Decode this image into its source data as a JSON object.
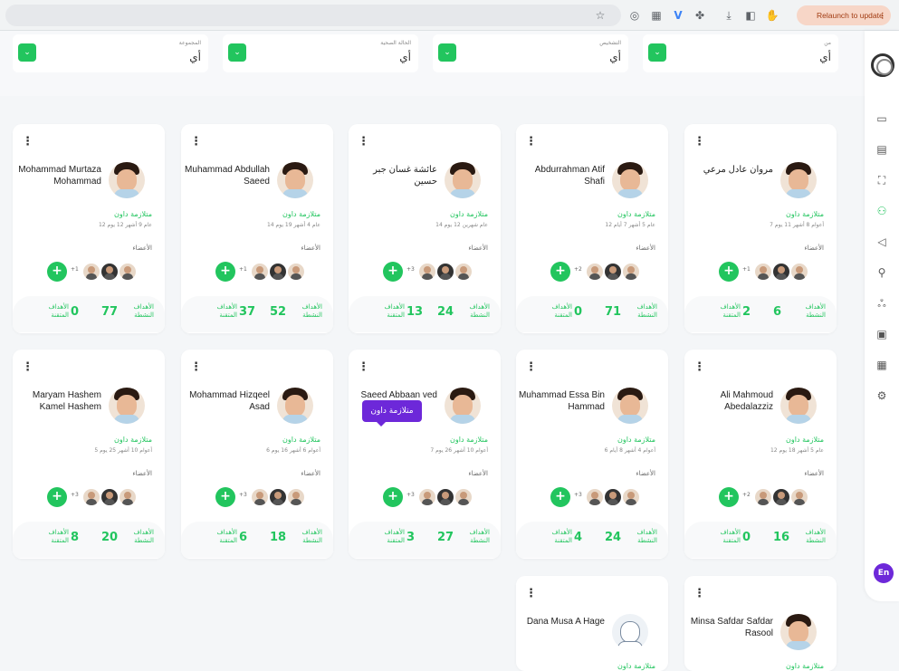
{
  "browser": {
    "relaunch_label": "Relaunch to update",
    "icons": [
      "star-icon",
      "camera-icon",
      "extension-icon",
      "vue-icon",
      "puzzle-icon",
      "download-icon",
      "sidebar-icon",
      "hand-icon"
    ]
  },
  "filters": [
    {
      "label": "المجموعة",
      "value": "أي"
    },
    {
      "label": "الحالة الصحية",
      "value": "أي"
    },
    {
      "label": "التشخيص",
      "value": "أي"
    },
    {
      "label": "من",
      "value": "أي"
    }
  ],
  "sidebar": {
    "icons": [
      "monitor-icon",
      "book-icon",
      "team-icon",
      "groups-icon",
      "megaphone-icon",
      "people-icon",
      "community-icon",
      "clipboard-icon",
      "calendar-check-icon",
      "settings-icon"
    ],
    "active_index": 3,
    "lang_label": "En"
  },
  "members_label": "الأعضاء",
  "active_goals_label": "الأهداف النشطة",
  "achieved_goals_label": "الأهداف المتقنة",
  "tooltip_text": "متلازمة داون",
  "cards": [
    {
      "name": "مروان عادل مرعي",
      "diagnosis": "متلازمة داون",
      "age": "7 أعوام 8 أشهر 11 يوم",
      "more": "+1",
      "active": "6",
      "achieved": "2",
      "placeholder": false
    },
    {
      "name": "Abdurrahman Atif Shafi",
      "diagnosis": "متلازمة داون",
      "age": "12 عام 5 أشهر 7 أيام",
      "more": "+2",
      "active": "71",
      "achieved": "0",
      "placeholder": false
    },
    {
      "name": "عائشة غسان جبر حسين",
      "diagnosis": "متلازمة داون",
      "age": "14 عام شهرين 12 يوم",
      "more": "+3",
      "active": "24",
      "achieved": "13",
      "placeholder": false
    },
    {
      "name": "Muhammad Abdullah Saeed",
      "diagnosis": "متلازمة داون",
      "age": "14 عام 4 أشهر 19 يوم",
      "more": "+1",
      "active": "52",
      "achieved": "37",
      "placeholder": false
    },
    {
      "name": "Mohammad Murtaza Mohammad",
      "diagnosis": "متلازمة داون",
      "age": "12 عام 9 أشهر 12 يوم",
      "more": "+1",
      "active": "77",
      "achieved": "0",
      "placeholder": false
    },
    {
      "name": "Ali Mahmoud Abedalazziz",
      "diagnosis": "متلازمة داون",
      "age": "12 عام 5 أشهر 18 يوم",
      "more": "+2",
      "active": "16",
      "achieved": "0",
      "placeholder": false
    },
    {
      "name": "Muhammad Essa Bin Hammad",
      "diagnosis": "متلازمة داون",
      "age": "6 أعوام 4 أشهر 8 أيام",
      "more": "+3",
      "active": "24",
      "achieved": "4",
      "placeholder": false
    },
    {
      "name": "Saeed Abbaan ved",
      "diagnosis": "متلازمة داون",
      "age": "7 أعوام 10 أشهر 26 يوم",
      "more": "+3",
      "active": "27",
      "achieved": "3",
      "placeholder": false
    },
    {
      "name": "Mohammad Hizqeel Asad",
      "diagnosis": "متلازمة داون",
      "age": "6 أعوام 6 أشهر 16 يوم",
      "more": "+3",
      "active": "18",
      "achieved": "6",
      "placeholder": false
    },
    {
      "name": "Maryam Hashem Kamel Hashem",
      "diagnosis": "متلازمة داون",
      "age": "5 أعوام 10 أشهر 25 يوم",
      "more": "+3",
      "active": "20",
      "achieved": "8",
      "placeholder": false
    },
    {
      "name": "Minsa Safdar Safdar Rasool",
      "diagnosis": "متلازمة داون",
      "age": "",
      "more": "",
      "active": "",
      "achieved": "",
      "placeholder": false
    },
    {
      "name": "Dana Musa A Hage",
      "diagnosis": "متلازمة داون",
      "age": "",
      "more": "",
      "active": "",
      "achieved": "",
      "placeholder": true
    }
  ]
}
